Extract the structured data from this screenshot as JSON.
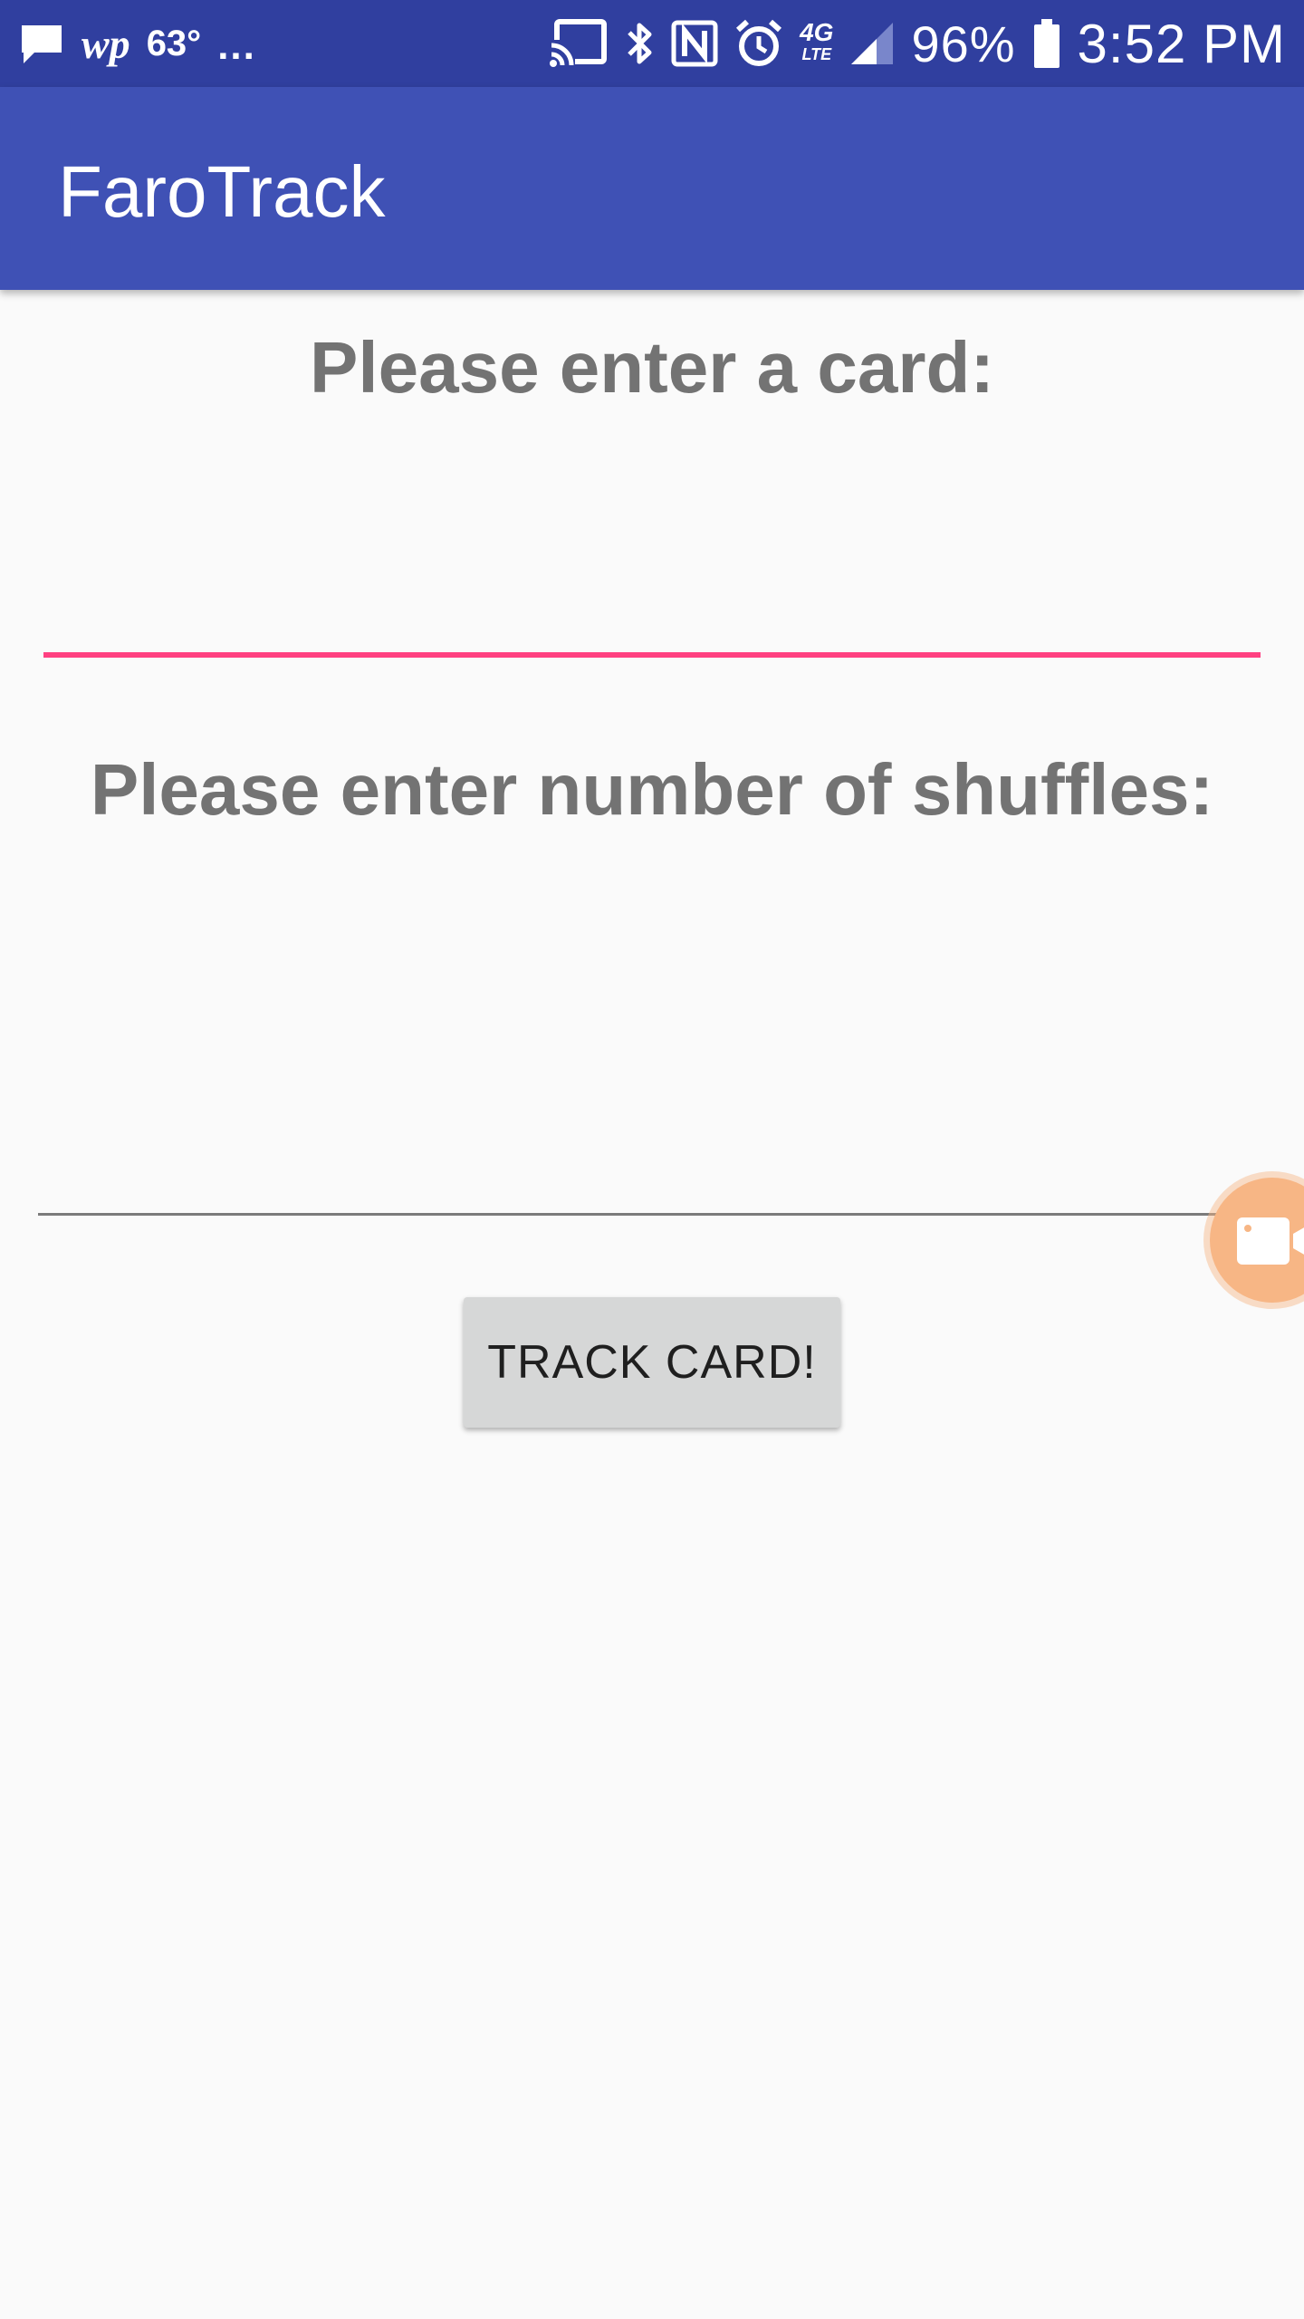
{
  "status_bar": {
    "icons": [
      "chat-bubble-icon",
      "washington-post-icon",
      "cast-icon",
      "bluetooth-icon",
      "nfc-icon",
      "alarm-icon",
      "signal-icon",
      "battery-icon"
    ],
    "wp_text": "wp",
    "temperature": "63°",
    "more": "...",
    "network": "4G",
    "network_sub": "LTE",
    "battery": "96%",
    "time": "3:52 PM"
  },
  "app_bar": {
    "title": "FaroTrack",
    "color": "#3f51b5",
    "status_color": "#303f9f"
  },
  "form": {
    "card_label": "Please enter a card:",
    "card_value": "",
    "shuffles_label": "Please enter number of shuffles:",
    "shuffles_value": "",
    "accent_color": "#ff4081"
  },
  "button": {
    "track_label": "TRACK CARD!"
  },
  "overlay": {
    "icon": "video-camera-icon",
    "color": "#f7b685"
  }
}
